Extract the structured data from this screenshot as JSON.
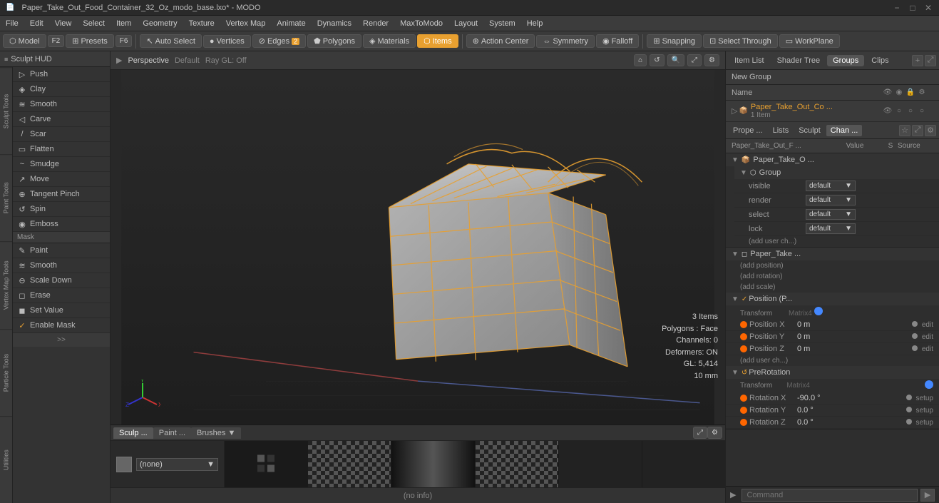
{
  "titlebar": {
    "title": "Paper_Take_Out_Food_Container_32_Oz_modo_base.lxo* - MODO",
    "min_label": "−",
    "max_label": "□",
    "close_label": "✕"
  },
  "menubar": {
    "items": [
      "File",
      "Edit",
      "View",
      "Select",
      "Item",
      "Geometry",
      "Texture",
      "Vertex Map",
      "Animate",
      "Dynamics",
      "Render",
      "MaxToModo",
      "Layout",
      "System",
      "Help"
    ]
  },
  "toolbar": {
    "mode_buttons": [
      {
        "label": "Model",
        "active": false
      },
      {
        "label": "F2",
        "active": false
      },
      {
        "label": "Presets",
        "active": false
      },
      {
        "label": "F6",
        "active": false
      }
    ],
    "selection_buttons": [
      {
        "label": "Auto Select",
        "active": false
      },
      {
        "label": "Vertices",
        "active": false,
        "count": ""
      },
      {
        "label": "Edges",
        "active": false,
        "count": "2"
      },
      {
        "label": "Polygons",
        "active": false
      },
      {
        "label": "Materials",
        "active": false
      },
      {
        "label": "Items",
        "active": true
      },
      {
        "label": "Action Center",
        "active": false
      },
      {
        "label": "Symmetry",
        "active": false
      },
      {
        "label": "Falloff",
        "active": false
      },
      {
        "label": "Snapping",
        "active": false
      },
      {
        "label": "Select Through",
        "active": false
      },
      {
        "label": "WorkPlane",
        "active": false
      }
    ]
  },
  "sculpt_hud": "Sculpt HUD",
  "tool_sections": {
    "sculpt_tools_label": "Sculpt Tools",
    "paint_tools_label": "Paint Tools",
    "vertex_map_label": "Vertex Map Tools",
    "particle_tools_label": "Particle Tools",
    "utilities_label": "Utilities"
  },
  "tools": [
    {
      "name": "Push",
      "icon": "▷"
    },
    {
      "name": "Clay",
      "icon": "◈"
    },
    {
      "name": "Smooth",
      "icon": "≋"
    },
    {
      "name": "Carve",
      "icon": "◁"
    },
    {
      "name": "Scar",
      "icon": "/"
    },
    {
      "name": "Flatten",
      "icon": "▭"
    },
    {
      "name": "Smudge",
      "icon": "~"
    },
    {
      "name": "Move",
      "icon": "↗"
    },
    {
      "name": "Tangent Pinch",
      "icon": "⊕"
    },
    {
      "name": "Spin",
      "icon": "↺"
    },
    {
      "name": "Emboss",
      "icon": "◉"
    }
  ],
  "mask": {
    "label": "Mask",
    "tools": [
      {
        "name": "Paint",
        "icon": "✎"
      },
      {
        "name": "Smooth",
        "icon": "≋"
      },
      {
        "name": "Scale Down",
        "icon": "⊖"
      }
    ],
    "actions": [
      {
        "name": "Erase",
        "icon": "◻"
      },
      {
        "name": "Set Value",
        "icon": "◼"
      },
      {
        "name": "Enable Mask",
        "icon": "✓",
        "active": true
      }
    ]
  },
  "viewport": {
    "mode": "Perspective",
    "shading": "Default",
    "ray": "Ray GL: Off",
    "stats": {
      "items": "3 Items",
      "polygons": "Polygons : Face",
      "channels": "Channels: 0",
      "deformers": "Deformers: ON",
      "gl": "GL: 5,414",
      "mm": "10 mm"
    }
  },
  "bottom_tabs": [
    {
      "label": "Sculp ...",
      "active": true
    },
    {
      "label": "Paint ...",
      "active": false
    },
    {
      "label": "Brushes",
      "active": false
    }
  ],
  "material": {
    "current": "(none)"
  },
  "scene_panel": {
    "tabs": [
      "Item List",
      "Shader Tree",
      "Groups",
      "Clips"
    ],
    "active_tab": "Groups",
    "new_group_label": "New Group",
    "columns": {
      "name": "Name",
      "s": "S",
      "source": "Source"
    },
    "items": [
      {
        "name": "Paper_Take_O ...",
        "children": [
          {
            "name": "Paper_Take_O ...",
            "subtitle": "1 Item",
            "type": "group"
          }
        ]
      }
    ],
    "item_name": "Paper_Take_Out_Co ...",
    "item_count": "1 Item"
  },
  "props": {
    "tabs": [
      "Prope ...",
      "Lists",
      "Sculpt",
      "Chan ...",
      "☆",
      "☰"
    ],
    "active_tab": "Chan ...",
    "header": {
      "item_path": "Paper_Take_Out_F ...",
      "value_label": "Value",
      "s_label": "S",
      "source_label": "Source"
    },
    "sections": [
      {
        "name": "Paper_Take_O ...",
        "expanded": true,
        "type": "group-root",
        "children": [
          {
            "name": "Group",
            "expanded": true,
            "properties": [
              {
                "label": "visible",
                "value": "default",
                "type": "dropdown"
              },
              {
                "label": "render",
                "value": "default",
                "type": "dropdown"
              },
              {
                "label": "select",
                "value": "default",
                "type": "dropdown"
              },
              {
                "label": "lock",
                "value": "default",
                "type": "dropdown"
              }
            ],
            "actions": [
              "(add user ch...)"
            ]
          }
        ]
      },
      {
        "name": "Paper_Take ...",
        "expanded": true,
        "type": "item",
        "actions": [
          "(add position)",
          "(add rotation)",
          "(add scale)"
        ],
        "sub_sections": [
          {
            "name": "Position (P...",
            "expanded": true,
            "transform_label": "Transform",
            "transform_type": "Matrix4",
            "properties": [
              {
                "label": "Position X",
                "value": "0 m",
                "edit": "edit",
                "dot": "orange"
              },
              {
                "label": "Position Y",
                "value": "0 m",
                "edit": "edit",
                "dot": "orange"
              },
              {
                "label": "Position Z",
                "value": "0 m",
                "edit": "edit",
                "dot": "orange"
              }
            ],
            "actions": [
              "(add user ch...)"
            ]
          },
          {
            "name": "PreRotation",
            "expanded": true,
            "transform_label": "Transform",
            "transform_type": "Matrix4",
            "properties": [
              {
                "label": "Rotation X",
                "value": "-90.0 °",
                "edit": "setup",
                "dot": "orange"
              },
              {
                "label": "Rotation Y",
                "value": "0.0 °",
                "edit": "setup",
                "dot": "orange"
              },
              {
                "label": "Rotation Z",
                "value": "0.0 °",
                "edit": "setup",
                "dot": "orange"
              }
            ]
          }
        ]
      }
    ]
  },
  "command_bar": {
    "placeholder": "Command"
  },
  "info_bar": {
    "text": "(no info)"
  }
}
